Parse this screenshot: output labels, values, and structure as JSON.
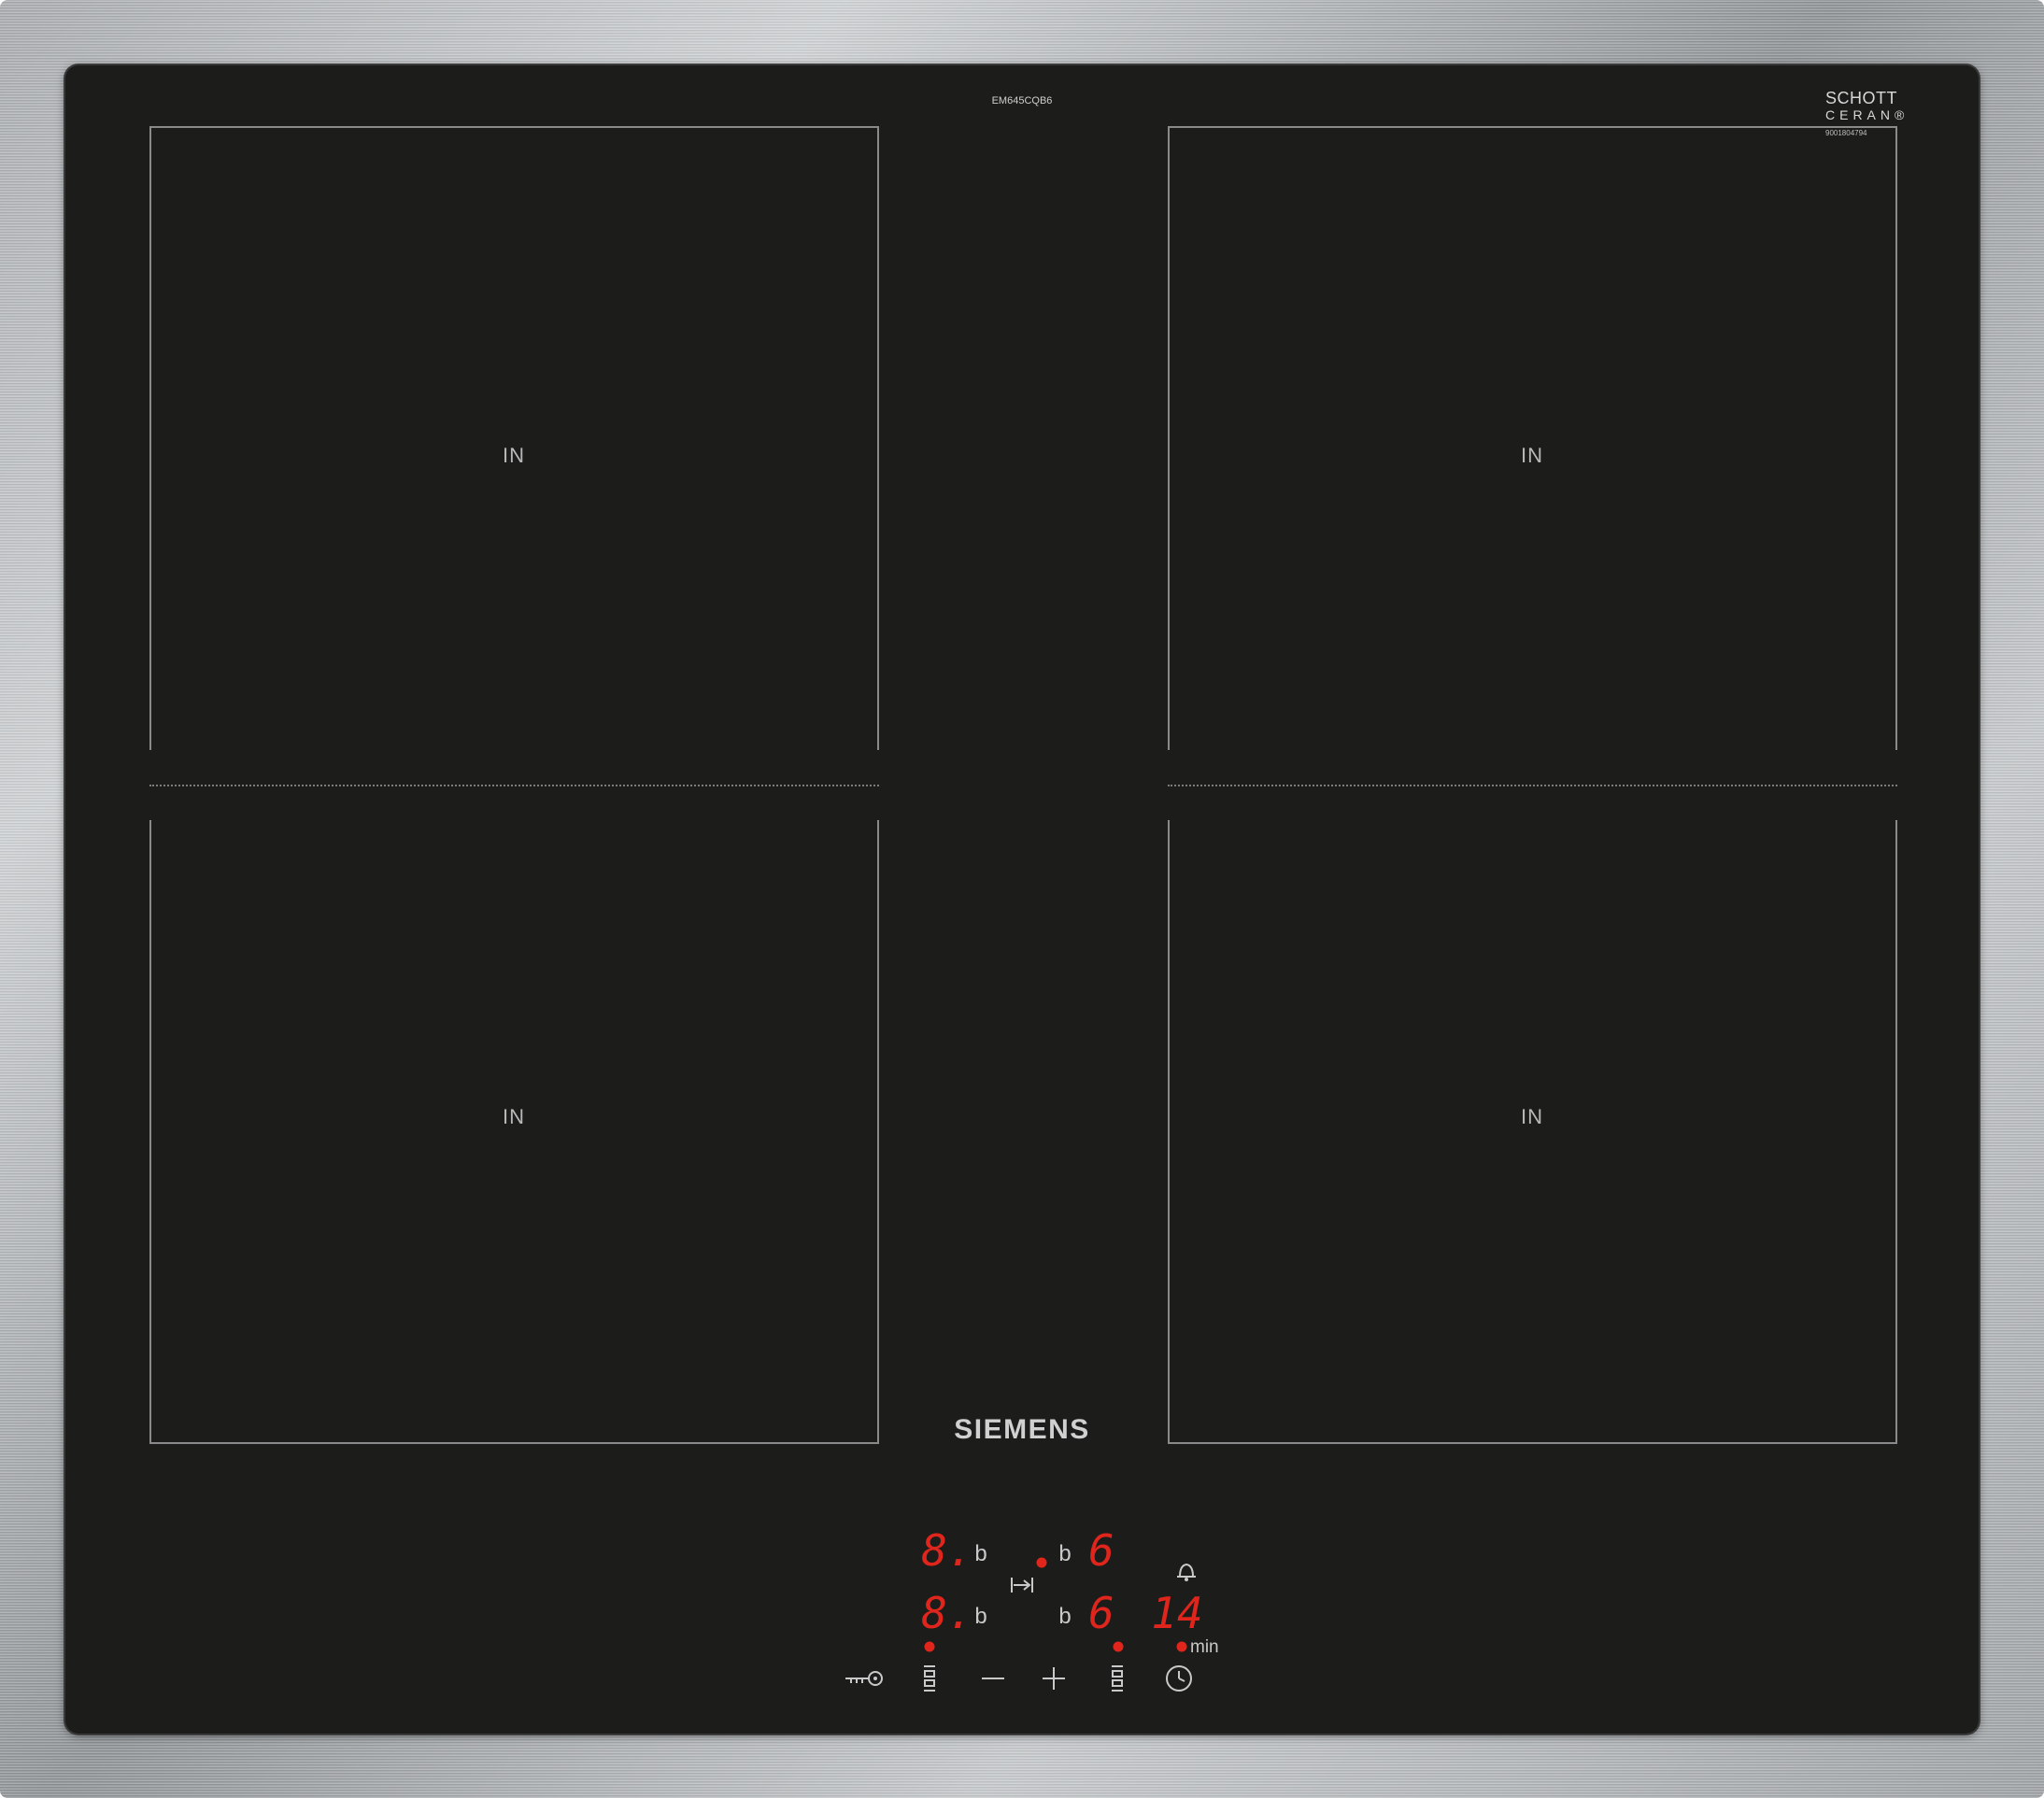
{
  "model_number": "EM645CQB6",
  "brand": "SIEMENS",
  "glass_maker": {
    "line1": "SCHOTT",
    "line2": "CERAN®",
    "serial": "9001804794"
  },
  "zones": [
    {
      "name": "front-left",
      "label": "IN"
    },
    {
      "name": "rear-left",
      "label": "IN"
    },
    {
      "name": "rear-right",
      "label": "IN"
    },
    {
      "name": "front-right",
      "label": "IN"
    }
  ],
  "display": {
    "left_top_digit": "8.",
    "left_bottom_digit": "8.",
    "right_top_digit": "6",
    "right_bottom_digit": "6",
    "booster_letter": "b",
    "timer_value": "14",
    "timer_unit": "min"
  },
  "controls": [
    "key-lock",
    "zone-select-left",
    "minus",
    "plus",
    "zone-select-right",
    "timer"
  ],
  "colors": {
    "glass": "#1c1c1a",
    "display_red": "#e0261c",
    "zone_line": "#8a8a8a",
    "frame": "#b5b8bb"
  }
}
